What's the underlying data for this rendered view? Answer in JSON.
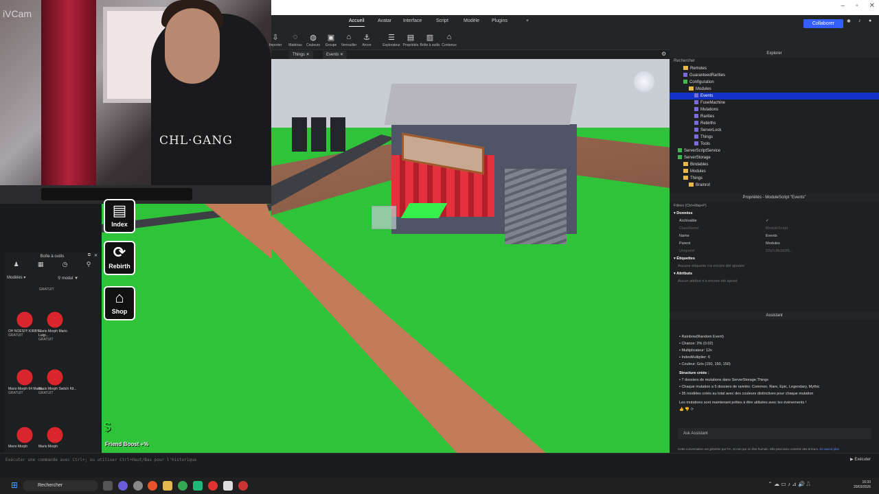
{
  "webcam": {
    "watermark": "iVCam",
    "hoodie_text": "CHL·GANG"
  },
  "ribbon": {
    "tabs": [
      "Accueil",
      "Avatar",
      "Interface",
      "Script",
      "Modèle",
      "Plugins"
    ],
    "active_tab": "Accueil",
    "collab_label": "Collaborer",
    "tools": [
      {
        "label": "Importer",
        "icon": "import-icon"
      },
      {
        "label": "Matériau",
        "icon": "material-icon"
      },
      {
        "label": "Couleurs",
        "icon": "color-icon"
      },
      {
        "label": "Groupe",
        "icon": "group-icon"
      },
      {
        "label": "Verrouiller",
        "icon": "lock-icon"
      },
      {
        "label": "Ancre",
        "icon": "anchor-icon"
      },
      {
        "label": "Explorateur",
        "icon": "explorer-icon"
      },
      {
        "label": "Propriétés",
        "icon": "properties-icon"
      },
      {
        "label": "Boîte à outils",
        "icon": "toolbox-icon"
      },
      {
        "label": "Contenus",
        "icon": "assets-icon"
      }
    ]
  },
  "doc_tabs": [
    "Things",
    "Events"
  ],
  "game_ui": {
    "buttons": [
      {
        "label": "Index",
        "icon": "book-icon"
      },
      {
        "label": "Rebirth",
        "icon": "refresh-icon"
      },
      {
        "label": "Shop",
        "icon": "shop-icon"
      }
    ],
    "friend_boost": "Friend Boost +%",
    "dollar": "$"
  },
  "toolbox": {
    "title": "Boîte à outils",
    "filter": "Modèles",
    "search_value": "modul",
    "top_tag": "GRATUIT",
    "items": [
      {
        "name": "OH NOES!!!! KIRBY...",
        "tag": "GRATUIT"
      },
      {
        "name": "Mario Morph Mario Luigi...",
        "tag": "GRATUIT"
      },
      {
        "name": "Mario Morph 64 Mario...",
        "tag": "GRATUIT"
      },
      {
        "name": "Mario Morph Switch Kit...",
        "tag": "GRATUIT"
      },
      {
        "name": "Mario Morph",
        "tag": ""
      },
      {
        "name": "Mario Morph",
        "tag": ""
      }
    ]
  },
  "explorer": {
    "title": "Explorer",
    "search_placeholder": "Rechercher",
    "items": [
      {
        "label": "Remotes",
        "kind": "folder",
        "indent": 2
      },
      {
        "label": "GuaranteedRarities",
        "kind": "module",
        "indent": 2
      },
      {
        "label": "Configuration",
        "kind": "config",
        "indent": 2
      },
      {
        "label": "Modules",
        "kind": "folder",
        "indent": 3
      },
      {
        "label": "Events",
        "kind": "module",
        "indent": 4,
        "selected": true
      },
      {
        "label": "FuseMachine",
        "kind": "module",
        "indent": 4
      },
      {
        "label": "Mutations",
        "kind": "module",
        "indent": 4
      },
      {
        "label": "Rarities",
        "kind": "module",
        "indent": 4
      },
      {
        "label": "Rebirths",
        "kind": "module",
        "indent": 4
      },
      {
        "label": "ServerLock",
        "kind": "module",
        "indent": 4
      },
      {
        "label": "Things",
        "kind": "module",
        "indent": 4
      },
      {
        "label": "Tools",
        "kind": "module",
        "indent": 4
      },
      {
        "label": "ServerScriptService",
        "kind": "service",
        "indent": 1
      },
      {
        "label": "ServerStorage",
        "kind": "service",
        "indent": 1
      },
      {
        "label": "Bindables",
        "kind": "folder",
        "indent": 2
      },
      {
        "label": "Modules",
        "kind": "folder",
        "indent": 2
      },
      {
        "label": "Things",
        "kind": "folder",
        "indent": 2
      },
      {
        "label": "Brainrot",
        "kind": "folder",
        "indent": 3
      }
    ]
  },
  "properties": {
    "title": "Propriétés - ModuleScript \"Events\"",
    "filter_placeholder": "Filtres (Ctrl+Maj+P)",
    "section_data": "Données",
    "rows": [
      {
        "name": "Archivable",
        "value": "✓"
      },
      {
        "name": "ClassName",
        "value": "ModuleScript"
      },
      {
        "name": "Name",
        "value": "Events"
      },
      {
        "name": "Parent",
        "value": "Modules"
      },
      {
        "name": "UniqueId",
        "value": "02a7c8b3d3f5..."
      }
    ],
    "section_tags": "Étiquettes",
    "tags_empty": "Aucune étiquette n'a encore été ajoutée",
    "section_attrs": "Attributs",
    "attrs_empty": "Aucun attribut n'a encore été ajouté"
  },
  "assistant": {
    "title": "Assistant",
    "lines": [
      "• Rainbow(Random Event)",
      "• Chance: 2% (0.02)",
      "• Multiplicateur: 12x",
      "• IndexMultiplier: 6",
      "• Couleur: Gris (150, 150, 150)"
    ],
    "structure_title": "Structure créée :",
    "structure_lines": [
      "• 7 dossiers de mutations dans ServerStorage.Things",
      "• Chaque mutation a 5 dossiers de raretés: Common, Rare, Epic, Legendary, Mythic",
      "• 35 modèles créés au total avec des couleurs distinctives pour chaque mutation"
    ],
    "conclusion": "Les mutations sont maintenant prêtes à être utilisées avec tes événements !",
    "ask_placeholder": "Ask Assistant",
    "disclaimer": "Cette conversation est générée par l'IA, et non par un être humain. Elle peut donc contenir des erreurs.",
    "learn_more": "En savoir plus"
  },
  "command_bar": {
    "placeholder": "Exécuter une commande avec Ctrl+; ou utiliser Ctrl+Haut/Bas pour l'historique",
    "run_label": "Exécuter"
  },
  "taskbar": {
    "search": "Rechercher",
    "time": "16:33",
    "date": "20/03/2026"
  },
  "colors": {
    "accent": "#335fff",
    "grass": "#2ec339",
    "road": "#c27c58",
    "selection": "#1232c8"
  }
}
